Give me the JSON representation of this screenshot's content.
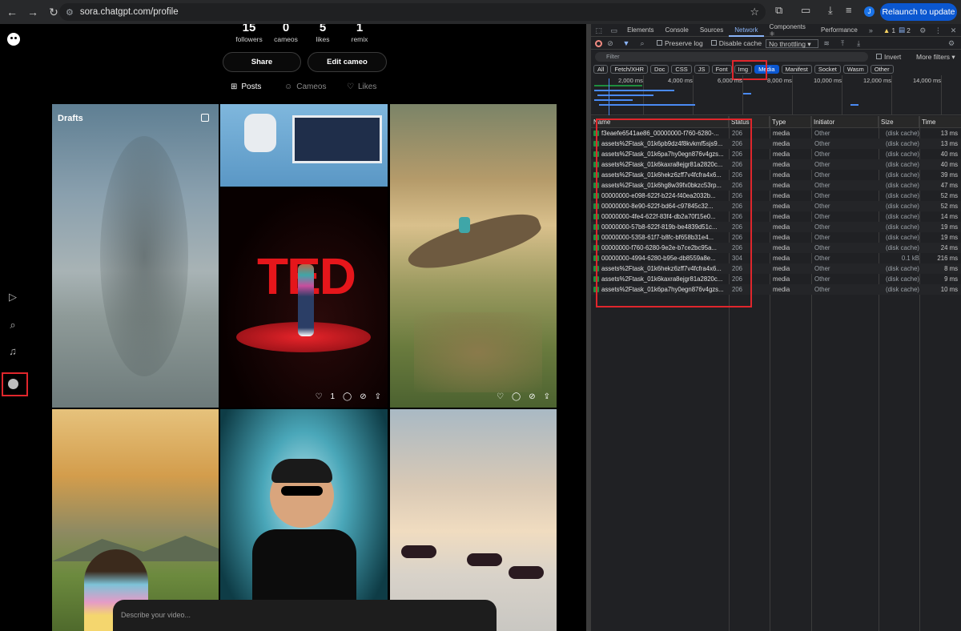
{
  "browser": {
    "url": "sora.chatgpt.com/profile",
    "relaunch_label": "Relaunch to update",
    "profile_initial": "J"
  },
  "profile": {
    "stats": [
      {
        "num": "15",
        "label": "followers"
      },
      {
        "num": "0",
        "label": "cameos"
      },
      {
        "num": "5",
        "label": "likes"
      },
      {
        "num": "1",
        "label": "remix"
      }
    ],
    "share_label": "Share",
    "edit_cameo_label": "Edit cameo",
    "tabs": [
      {
        "label": "Posts",
        "icon": "posts-icon"
      },
      {
        "label": "Cameos",
        "icon": "cameo-icon"
      },
      {
        "label": "Likes",
        "icon": "heart-icon"
      }
    ],
    "drafts_label": "Drafts",
    "ted_likes": "1",
    "prompt_placeholder": "Describe your video..."
  },
  "devtools": {
    "tabs": [
      "Elements",
      "Console",
      "Sources",
      "Network",
      "Components ⚛",
      "Performance"
    ],
    "active_tab": "Network",
    "issues_warn": "1",
    "issues_msg": "2",
    "preserve_log": "Preserve log",
    "disable_cache": "Disable cache",
    "throttling": "No throttling",
    "filter_placeholder": "Filter",
    "invert": "Invert",
    "more_filters": "More filters",
    "types": [
      "All",
      "Fetch/XHR",
      "Doc",
      "CSS",
      "JS",
      "Font",
      "Img",
      "Media",
      "Manifest",
      "Socket",
      "Wasm",
      "Other"
    ],
    "active_type": "Media",
    "timeline_ticks": [
      "2,000 ms",
      "4,000 ms",
      "6,000 ms",
      "8,000 ms",
      "10,000 ms",
      "12,000 ms",
      "14,000 ms"
    ],
    "columns": [
      "Name",
      "Status",
      "Type",
      "Initiator",
      "Size",
      "Time"
    ],
    "rows": [
      {
        "name": "f3eaefe6541ae86_00000000-f760-6280-...",
        "status": "206",
        "type": "media",
        "initiator": "Other",
        "size": "(disk cache)",
        "time": "13 ms"
      },
      {
        "name": "assets%2Ftask_01k6pb9dz4f8kvkmf5sjs9...",
        "status": "206",
        "type": "media",
        "initiator": "Other",
        "size": "(disk cache)",
        "time": "13 ms"
      },
      {
        "name": "assets%2Ftask_01k6pa7hy0egn876v4gzs...",
        "status": "206",
        "type": "media",
        "initiator": "Other",
        "size": "(disk cache)",
        "time": "40 ms"
      },
      {
        "name": "assets%2Ftask_01k6kaxra8ejgr81a2820c...",
        "status": "206",
        "type": "media",
        "initiator": "Other",
        "size": "(disk cache)",
        "time": "40 ms"
      },
      {
        "name": "assets%2Ftask_01k6hekz6zff7v4fcfra4x6...",
        "status": "206",
        "type": "media",
        "initiator": "Other",
        "size": "(disk cache)",
        "time": "39 ms"
      },
      {
        "name": "assets%2Ftask_01k6hg8w39fx0bkzc53rp...",
        "status": "206",
        "type": "media",
        "initiator": "Other",
        "size": "(disk cache)",
        "time": "47 ms"
      },
      {
        "name": "00000000-e098-622f-b224-f40ea2032b...",
        "status": "206",
        "type": "media",
        "initiator": "Other",
        "size": "(disk cache)",
        "time": "52 ms"
      },
      {
        "name": "00000000-8e90-622f-bd64-c97845c32...",
        "status": "206",
        "type": "media",
        "initiator": "Other",
        "size": "(disk cache)",
        "time": "52 ms"
      },
      {
        "name": "00000000-4fe4-622f-83f4-db2a70f15e0...",
        "status": "206",
        "type": "media",
        "initiator": "Other",
        "size": "(disk cache)",
        "time": "14 ms"
      },
      {
        "name": "00000000-57b8-622f-819b-be4839d51c...",
        "status": "206",
        "type": "media",
        "initiator": "Other",
        "size": "(disk cache)",
        "time": "19 ms"
      },
      {
        "name": "00000000-5358-61f7-b8fc-bf658b31e4...",
        "status": "206",
        "type": "media",
        "initiator": "Other",
        "size": "(disk cache)",
        "time": "19 ms"
      },
      {
        "name": "00000000-f760-6280-9e2e-b7ce2bc95a...",
        "status": "206",
        "type": "media",
        "initiator": "Other",
        "size": "(disk cache)",
        "time": "24 ms"
      },
      {
        "name": "00000000-4994-6280-b95e-db8559a8e...",
        "status": "304",
        "type": "media",
        "initiator": "Other",
        "size": "0.1 kB",
        "time": "216 ms"
      },
      {
        "name": "assets%2Ftask_01k6hekz6zff7v4fcfra4x6...",
        "status": "206",
        "type": "media",
        "initiator": "Other",
        "size": "(disk cache)",
        "time": "8 ms"
      },
      {
        "name": "assets%2Ftask_01k6kaxra8ejgr81a2820c...",
        "status": "206",
        "type": "media",
        "initiator": "Other",
        "size": "(disk cache)",
        "time": "9 ms"
      },
      {
        "name": "assets%2Ftask_01k6pa7hy0egn876v4gzs...",
        "status": "206",
        "type": "media",
        "initiator": "Other",
        "size": "(disk cache)",
        "time": "10 ms"
      }
    ]
  }
}
